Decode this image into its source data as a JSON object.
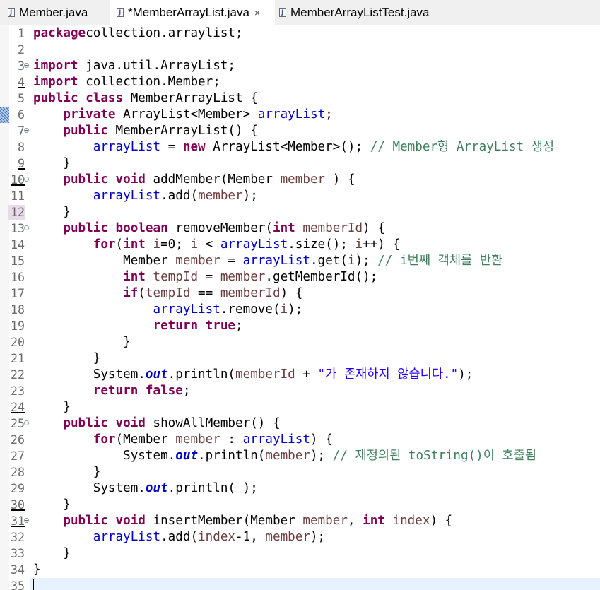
{
  "tabs": [
    {
      "label": "Member.java",
      "icon": "java-file-icon",
      "active": false
    },
    {
      "label": "*MemberArrayList.java",
      "icon": "java-file-icon",
      "active": true,
      "close": "×"
    },
    {
      "label": "MemberArrayListTest.java",
      "icon": "java-file-icon",
      "active": false
    }
  ],
  "colors": {
    "keyword": "#7f0055",
    "field": "#0000c0",
    "local_variable": "#6a3e3e",
    "comment": "#3f7f5f",
    "string": "#2a00ff",
    "current_line": "#e8f2fe"
  },
  "editor": {
    "lines": [
      {
        "num": "1",
        "underline": false,
        "fold": false,
        "tokens": [
          [
            "kw",
            "package"
          ],
          [
            "",
            "collection.arraylist;"
          ]
        ]
      },
      {
        "num": "2",
        "underline": false,
        "fold": false,
        "tokens": []
      },
      {
        "num": "3",
        "underline": false,
        "fold": true,
        "tokens": [
          [
            "kw",
            "import"
          ],
          [
            "",
            " java.util.ArrayList;"
          ]
        ]
      },
      {
        "num": "4",
        "underline": true,
        "fold": false,
        "tokens": [
          [
            "kw",
            "import"
          ],
          [
            "",
            " collection.Member;"
          ]
        ]
      },
      {
        "num": "5",
        "underline": false,
        "fold": false,
        "tokens": [
          [
            "kw",
            "public"
          ],
          [
            "",
            " "
          ],
          [
            "kw",
            "class"
          ],
          [
            "",
            " MemberArrayList {"
          ]
        ]
      },
      {
        "num": "6",
        "underline": false,
        "fold": false,
        "marker": true,
        "tokens": [
          [
            "",
            "    "
          ],
          [
            "kw",
            "private"
          ],
          [
            "",
            " ArrayList<Member> "
          ],
          [
            "fld",
            "arrayList"
          ],
          [
            "",
            ";"
          ]
        ]
      },
      {
        "num": "7",
        "underline": false,
        "fold": true,
        "tokens": [
          [
            "",
            "    "
          ],
          [
            "kw",
            "public"
          ],
          [
            "",
            " MemberArrayList() {"
          ]
        ]
      },
      {
        "num": "8",
        "underline": false,
        "fold": false,
        "tokens": [
          [
            "",
            "        "
          ],
          [
            "fld",
            "arrayList"
          ],
          [
            "",
            " = "
          ],
          [
            "kw",
            "new"
          ],
          [
            "",
            " ArrayList<Member>(); "
          ],
          [
            "cm",
            "// Member형 ArrayList 생성"
          ]
        ]
      },
      {
        "num": "9",
        "underline": true,
        "fold": false,
        "tokens": [
          [
            "",
            "    }"
          ]
        ]
      },
      {
        "num": "10",
        "underline": true,
        "fold": true,
        "tokens": [
          [
            "",
            "    "
          ],
          [
            "kw",
            "public"
          ],
          [
            "",
            " "
          ],
          [
            "kw",
            "void"
          ],
          [
            "",
            " addMember(Member "
          ],
          [
            "lv",
            "member"
          ],
          [
            "",
            " ) {"
          ]
        ]
      },
      {
        "num": "11",
        "underline": false,
        "fold": false,
        "tokens": [
          [
            "",
            "        "
          ],
          [
            "fld",
            "arrayList"
          ],
          [
            "",
            ".add("
          ],
          [
            "lv",
            "member"
          ],
          [
            "",
            ");"
          ]
        ]
      },
      {
        "num": "12",
        "underline": false,
        "fold": false,
        "highlight": true,
        "tokens": [
          [
            "",
            "    }"
          ]
        ]
      },
      {
        "num": "13",
        "underline": false,
        "fold": true,
        "tokens": [
          [
            "",
            "    "
          ],
          [
            "kw",
            "public"
          ],
          [
            "",
            " "
          ],
          [
            "kw",
            "boolean"
          ],
          [
            "",
            " removeMember("
          ],
          [
            "kw",
            "int"
          ],
          [
            "",
            " "
          ],
          [
            "lv",
            "memberId"
          ],
          [
            "",
            ") {"
          ]
        ]
      },
      {
        "num": "14",
        "underline": false,
        "fold": false,
        "tokens": [
          [
            "",
            "        "
          ],
          [
            "kw",
            "for"
          ],
          [
            "",
            "("
          ],
          [
            "kw",
            "int"
          ],
          [
            "",
            " "
          ],
          [
            "lv",
            "i"
          ],
          [
            "",
            "=0; "
          ],
          [
            "lv",
            "i"
          ],
          [
            "",
            " < "
          ],
          [
            "fld",
            "arrayList"
          ],
          [
            "",
            ".size(); "
          ],
          [
            "lv",
            "i"
          ],
          [
            "",
            "++) {"
          ]
        ]
      },
      {
        "num": "15",
        "underline": false,
        "fold": false,
        "tokens": [
          [
            "",
            "            Member "
          ],
          [
            "lv",
            "member"
          ],
          [
            "",
            " = "
          ],
          [
            "fld",
            "arrayList"
          ],
          [
            "",
            ".get("
          ],
          [
            "lv",
            "i"
          ],
          [
            "",
            "); "
          ],
          [
            "cm",
            "// i번째 객체를 반환"
          ]
        ]
      },
      {
        "num": "16",
        "underline": false,
        "fold": false,
        "tokens": [
          [
            "",
            "            "
          ],
          [
            "kw",
            "int"
          ],
          [
            "",
            " "
          ],
          [
            "lv",
            "tempId"
          ],
          [
            "",
            " = "
          ],
          [
            "lv",
            "member"
          ],
          [
            "",
            ".getMemberId();"
          ]
        ]
      },
      {
        "num": "17",
        "underline": false,
        "fold": false,
        "tokens": [
          [
            "",
            "            "
          ],
          [
            "kw",
            "if"
          ],
          [
            "",
            "("
          ],
          [
            "lv",
            "tempId"
          ],
          [
            "",
            " == "
          ],
          [
            "lv",
            "memberId"
          ],
          [
            "",
            ") {"
          ]
        ]
      },
      {
        "num": "18",
        "underline": false,
        "fold": false,
        "tokens": [
          [
            "",
            "                "
          ],
          [
            "fld",
            "arrayList"
          ],
          [
            "",
            ".remove("
          ],
          [
            "lv",
            "i"
          ],
          [
            "",
            ");"
          ]
        ]
      },
      {
        "num": "19",
        "underline": false,
        "fold": false,
        "tokens": [
          [
            "",
            "                "
          ],
          [
            "kw",
            "return"
          ],
          [
            "",
            " "
          ],
          [
            "kw",
            "true"
          ],
          [
            "",
            ";"
          ]
        ]
      },
      {
        "num": "20",
        "underline": false,
        "fold": false,
        "tokens": [
          [
            "",
            "            }"
          ]
        ]
      },
      {
        "num": "21",
        "underline": false,
        "fold": false,
        "tokens": [
          [
            "",
            "        }"
          ]
        ]
      },
      {
        "num": "22",
        "underline": false,
        "fold": false,
        "tokens": [
          [
            "",
            "        System."
          ],
          [
            "st",
            "out"
          ],
          [
            "",
            ".println("
          ],
          [
            "lv",
            "memberId"
          ],
          [
            "",
            " + "
          ],
          [
            "str",
            "\"가 존재하지 않습니다.\""
          ],
          [
            "",
            ");"
          ]
        ]
      },
      {
        "num": "23",
        "underline": false,
        "fold": false,
        "tokens": [
          [
            "",
            "        "
          ],
          [
            "kw",
            "return"
          ],
          [
            "",
            " "
          ],
          [
            "kw",
            "false"
          ],
          [
            "",
            ";"
          ]
        ]
      },
      {
        "num": "24",
        "underline": true,
        "fold": false,
        "tokens": [
          [
            "",
            "    }"
          ]
        ]
      },
      {
        "num": "25",
        "underline": false,
        "fold": true,
        "tokens": [
          [
            "",
            "    "
          ],
          [
            "kw",
            "public"
          ],
          [
            "",
            " "
          ],
          [
            "kw",
            "void"
          ],
          [
            "",
            " showAllMember() {"
          ]
        ]
      },
      {
        "num": "26",
        "underline": false,
        "fold": false,
        "tokens": [
          [
            "",
            "        "
          ],
          [
            "kw",
            "for"
          ],
          [
            "",
            "(Member "
          ],
          [
            "lv",
            "member"
          ],
          [
            "",
            " : "
          ],
          [
            "fld",
            "arrayList"
          ],
          [
            "",
            ") {"
          ]
        ]
      },
      {
        "num": "27",
        "underline": false,
        "fold": false,
        "tokens": [
          [
            "",
            "            System."
          ],
          [
            "st",
            "out"
          ],
          [
            "",
            ".println("
          ],
          [
            "lv",
            "member"
          ],
          [
            "",
            "); "
          ],
          [
            "cm",
            "// 재정의된 toString()이 호출됨"
          ]
        ]
      },
      {
        "num": "28",
        "underline": false,
        "fold": false,
        "tokens": [
          [
            "",
            "        }"
          ]
        ]
      },
      {
        "num": "29",
        "underline": false,
        "fold": false,
        "tokens": [
          [
            "",
            "        System."
          ],
          [
            "st",
            "out"
          ],
          [
            "",
            ".println( );"
          ]
        ]
      },
      {
        "num": "30",
        "underline": true,
        "fold": false,
        "tokens": [
          [
            "",
            "    }"
          ]
        ]
      },
      {
        "num": "31",
        "underline": true,
        "fold": true,
        "tokens": [
          [
            "",
            "    "
          ],
          [
            "kw",
            "public"
          ],
          [
            "",
            " "
          ],
          [
            "kw",
            "void"
          ],
          [
            "",
            " insertMember(Member "
          ],
          [
            "lv",
            "member"
          ],
          [
            "",
            ", "
          ],
          [
            "kw",
            "int"
          ],
          [
            "",
            " "
          ],
          [
            "lv",
            "index"
          ],
          [
            "",
            ") {"
          ]
        ]
      },
      {
        "num": "32",
        "underline": false,
        "fold": false,
        "tokens": [
          [
            "",
            "        "
          ],
          [
            "fld",
            "arrayList"
          ],
          [
            "",
            ".add("
          ],
          [
            "lv",
            "index"
          ],
          [
            "",
            "-1, "
          ],
          [
            "lv",
            "member"
          ],
          [
            "",
            ");"
          ]
        ]
      },
      {
        "num": "33",
        "underline": false,
        "fold": false,
        "tokens": [
          [
            "",
            "    }"
          ]
        ]
      },
      {
        "num": "34",
        "underline": false,
        "fold": false,
        "tokens": [
          [
            "",
            "}"
          ]
        ]
      },
      {
        "num": "35",
        "underline": false,
        "fold": false,
        "current": true,
        "tokens": []
      }
    ]
  }
}
